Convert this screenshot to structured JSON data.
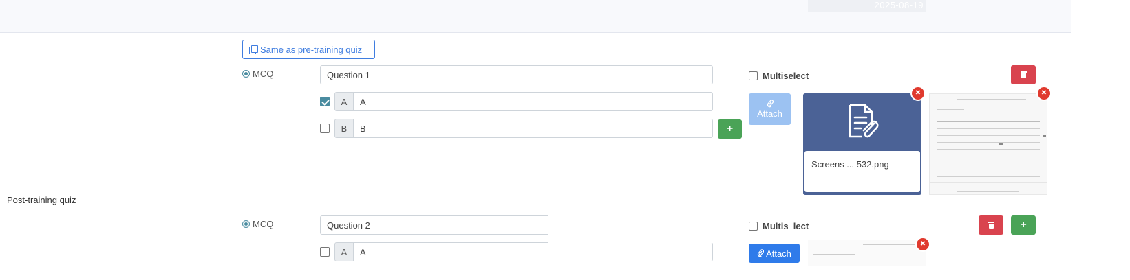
{
  "header": {
    "date_text": "2025-08-19"
  },
  "section": {
    "label": "Post-training quiz"
  },
  "toolbar": {
    "same_label": "Same as pre-training quiz"
  },
  "questions": [
    {
      "type_label": "MCQ",
      "question": "Question 1",
      "multiselect_label": "Multiselect",
      "attach_label": "Attach",
      "options": [
        {
          "letter": "A",
          "value": "A",
          "checked": true
        },
        {
          "letter": "B",
          "value": "B",
          "checked": false
        }
      ],
      "attachment": {
        "filename": "Screens ... 532.png"
      }
    },
    {
      "type_label": "MCQ",
      "question": "Question 2",
      "multiselect_label": "Multiselect",
      "attach_label": "Attach",
      "options": [
        {
          "letter": "A",
          "value": "A",
          "checked": false
        }
      ]
    }
  ],
  "icons": {
    "copy": "copy-icon",
    "plus": "plus-icon",
    "trash": "trash-icon",
    "paperclip": "paperclip-icon",
    "close": "close-icon",
    "document": "document-icon"
  },
  "colors": {
    "primary": "#3f7de0",
    "success": "#4aa357",
    "danger": "#d9434e",
    "card": "#4b6296",
    "radio": "#4a8ca0"
  }
}
